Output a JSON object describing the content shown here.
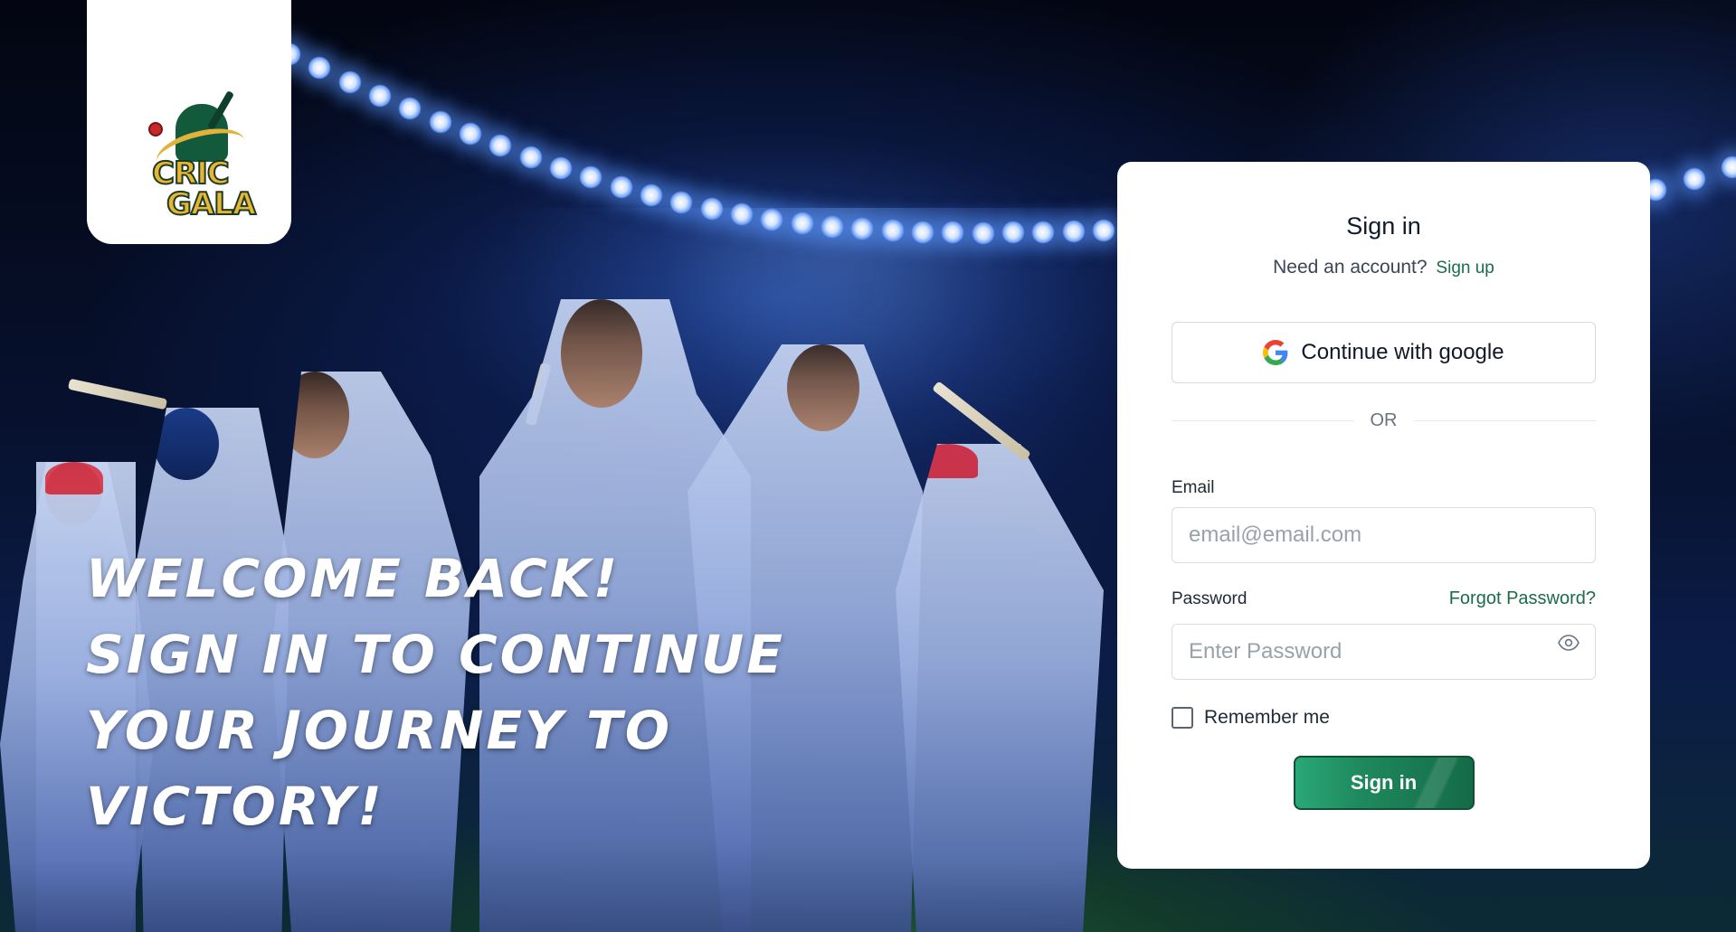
{
  "brand": {
    "logo_text_line1": "CRIC",
    "logo_text_line2": "GALA"
  },
  "hero": {
    "line1": "Welcome back!",
    "line2": "Sign in to continue",
    "line3": "your journey to",
    "line4": "victory!"
  },
  "signin_card": {
    "title": "Sign in",
    "need_account_text": "Need an account?",
    "signup_link": "Sign up",
    "google_button": "Continue with google",
    "divider_text": "OR",
    "email_label": "Email",
    "email_placeholder": "email@email.com",
    "email_value": "",
    "password_label": "Password",
    "forgot_password": "Forgot Password?",
    "password_placeholder": "Enter Password",
    "password_value": "",
    "remember_me": "Remember me",
    "remember_checked": false,
    "submit_button": "Sign in"
  },
  "icons": {
    "google": "google-icon",
    "eye": "eye-icon",
    "checkbox": "checkbox-icon"
  },
  "colors": {
    "accent_green": "#1c6b4a",
    "button_green": "#1f8a5e",
    "logo_gold": "#e6b533",
    "background_navy": "#07112e"
  }
}
